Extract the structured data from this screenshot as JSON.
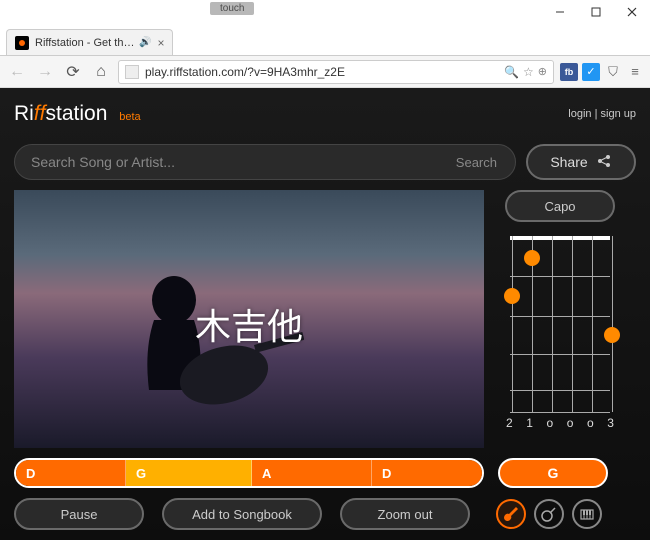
{
  "window": {
    "touch_label": "touch",
    "tab_title": "Riffstation - Get the cl",
    "url": "play.riffstation.com/?v=9HA3mhr_z2E"
  },
  "header": {
    "logo_pre": "Ri",
    "logo_ff": "ff",
    "logo_post": "station",
    "beta": "beta",
    "login": "login",
    "signup": "sign up"
  },
  "search": {
    "placeholder": "Search Song or Artist...",
    "button": "Search"
  },
  "share": {
    "label": "Share"
  },
  "capo": {
    "label": "Capo"
  },
  "video": {
    "overlay_text": "木吉他"
  },
  "chord_diagram": {
    "current_chord": "G",
    "fret_labels": [
      "2",
      "1",
      "o",
      "o",
      "o",
      "3"
    ],
    "fingers": [
      {
        "string": 0,
        "fret": 2
      },
      {
        "string": 1,
        "fret": 1
      },
      {
        "string": 5,
        "fret": 3
      }
    ]
  },
  "chord_timeline": [
    {
      "chord": "D"
    },
    {
      "chord": "G"
    },
    {
      "chord": "A"
    },
    {
      "chord": "D"
    }
  ],
  "controls": {
    "pause": "Pause",
    "add_songbook": "Add to Songbook",
    "zoom_out": "Zoom out"
  },
  "instruments": {
    "guitar": "guitar",
    "ukulele": "ukulele",
    "piano": "piano"
  }
}
